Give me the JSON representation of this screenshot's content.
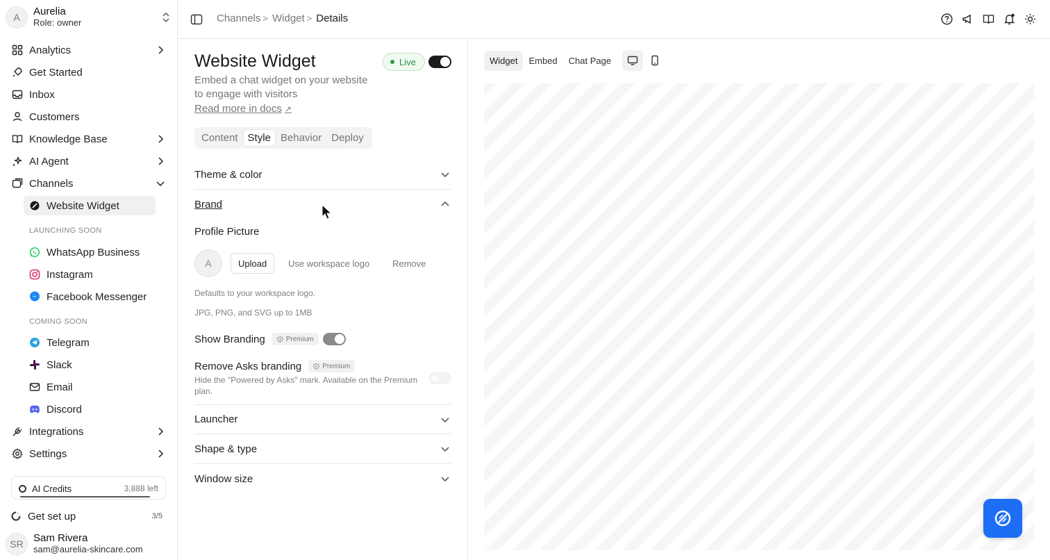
{
  "workspace": {
    "initial": "A",
    "name": "Aurelia",
    "role": "Role: owner"
  },
  "nav": {
    "analytics": "Analytics",
    "get_started": "Get Started",
    "inbox": "Inbox",
    "customers": "Customers",
    "knowledge_base": "Knowledge Base",
    "ai_agent": "AI Agent",
    "channels": "Channels",
    "website_widget": "Website Widget",
    "launching_soon": "LAUNCHING SOON",
    "whatsapp": "WhatsApp Business",
    "instagram": "Instagram",
    "messenger": "Facebook Messenger",
    "coming_soon": "COMING SOON",
    "telegram": "Telegram",
    "slack": "Slack",
    "email": "Email",
    "discord": "Discord",
    "integrations": "Integrations",
    "settings": "Settings"
  },
  "credits": {
    "label": "AI Credits",
    "left": "3,888 left",
    "used_fraction": 0.97
  },
  "setup": {
    "label": "Get set up",
    "count": "3/5"
  },
  "user": {
    "initials": "SR",
    "name": "Sam Rivera",
    "email": "sam@aurelia-skincare.com"
  },
  "breadcrumb": {
    "item1": "Channels",
    "item2": "Widget",
    "current": "Details",
    "sep": ">"
  },
  "header": {
    "title": "Website Widget",
    "status": "Live",
    "description": "Embed a chat widget on your website to engage with visitors",
    "docs_link": "Read more in docs",
    "docs_arrow": "↗"
  },
  "tabs": {
    "content": "Content",
    "style": "Style",
    "behavior": "Behavior",
    "deploy": "Deploy"
  },
  "sections": {
    "theme": "Theme & color",
    "brand": "Brand",
    "launcher": "Launcher",
    "shape": "Shape & type",
    "window": "Window size"
  },
  "brand": {
    "profile_label": "Profile Picture",
    "avatar_initial": "A",
    "upload": "Upload",
    "use_logo": "Use workspace logo",
    "remove": "Remove",
    "hint1": "Defaults to your workspace logo.",
    "hint2": "JPG, PNG, and SVG up to 1MB",
    "show_branding": "Show Branding",
    "premium": "Premium",
    "remove_branding": "Remove Asks branding",
    "remove_branding_desc": "Hide the \"Powered by Asks\" mark. Available on the Premium plan."
  },
  "preview": {
    "tab_widget": "Widget",
    "tab_embed": "Embed",
    "tab_chat": "Chat Page"
  },
  "colors": {
    "accent": "#1d6ef5",
    "live_green": "#2d8a44"
  }
}
